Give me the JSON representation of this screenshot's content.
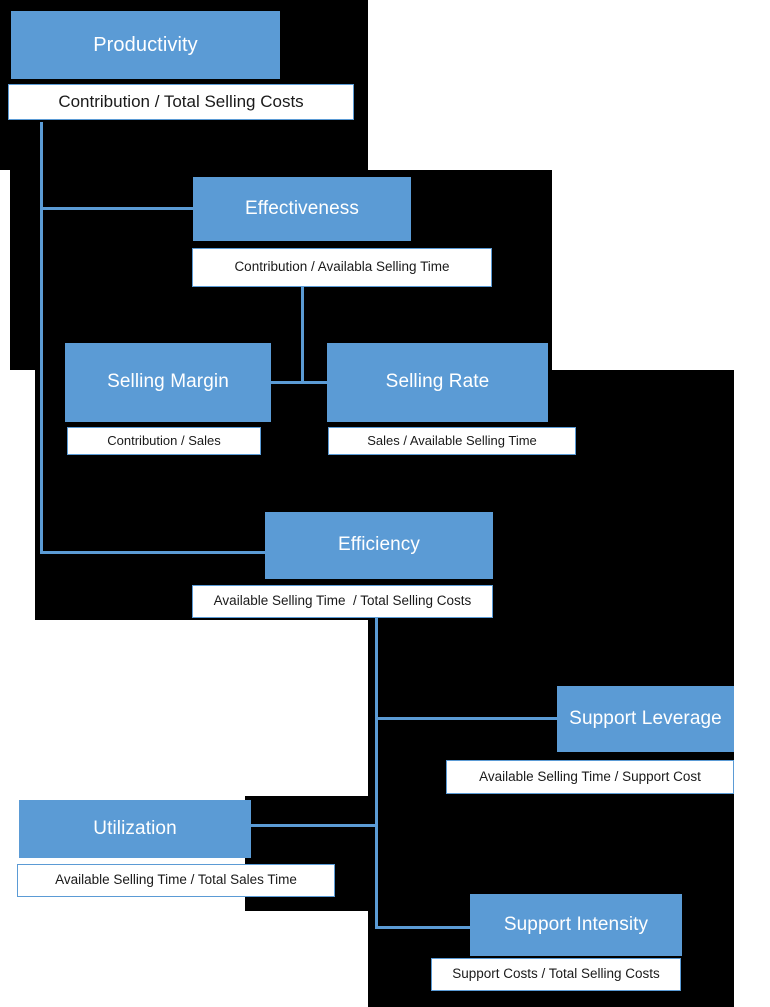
{
  "diagram": {
    "title_color": "#5B9BD5",
    "nodes": [
      {
        "id": "productivity",
        "title": "Productivity",
        "formula": "Contribution / Total Selling Costs"
      },
      {
        "id": "effectiveness",
        "title": "Effectiveness",
        "formula": "Contribution / Availabla Selling Time"
      },
      {
        "id": "selling_margin",
        "title": "Selling Margin",
        "formula": "Contribution / Sales"
      },
      {
        "id": "selling_rate",
        "title": "Selling Rate",
        "formula": "Sales / Available Selling Time"
      },
      {
        "id": "efficiency",
        "title": "Efficiency",
        "formula": "Available Selling Time  / Total Selling Costs"
      },
      {
        "id": "support_leverage",
        "title": "Support Leverage",
        "formula": "Available Selling Time / Support Cost"
      },
      {
        "id": "utilization",
        "title": "Utilization",
        "formula": "Available Selling Time / Total Sales Time"
      },
      {
        "id": "support_intensity",
        "title": "Support Intensity",
        "formula": "Support Costs / Total Selling Costs"
      }
    ]
  }
}
